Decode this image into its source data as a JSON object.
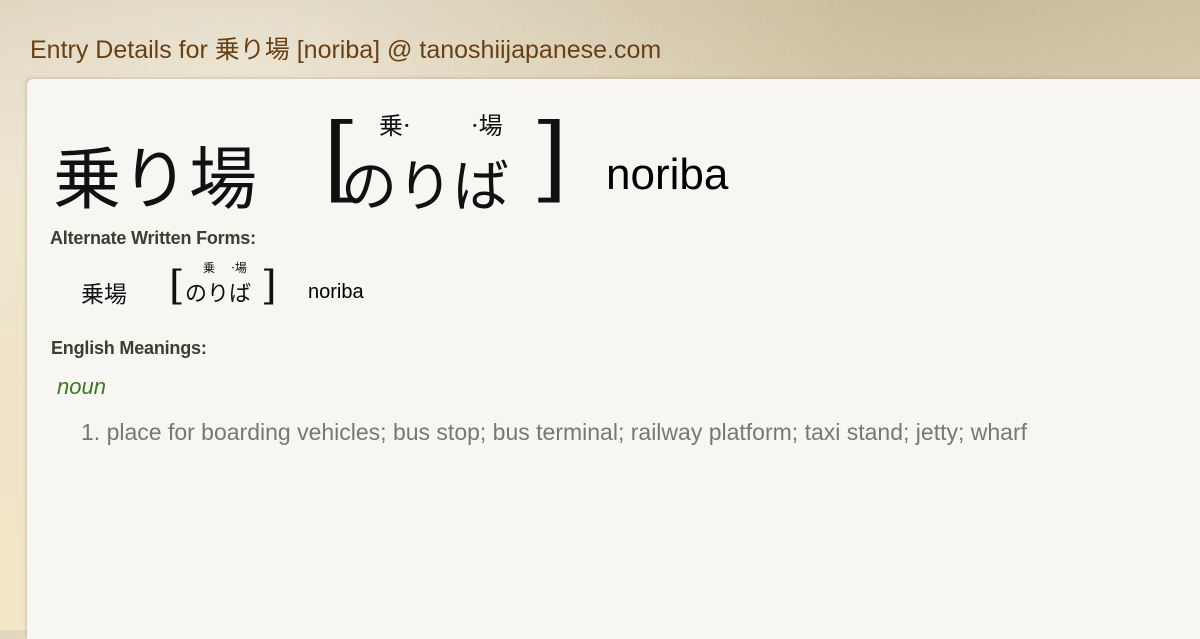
{
  "header": {
    "title": "Entry Details for 乗り場 [noriba] @ tanoshiijapanese.com"
  },
  "entry": {
    "kanji": "乗り場",
    "bracket_open": "[",
    "kana": "のりば",
    "bracket_close": "]",
    "furigana_left": "乗·",
    "furigana_right": "·場",
    "romaji": "noriba"
  },
  "alternate": {
    "label": "Alternate Written Forms:",
    "forms": [
      {
        "kanji": "乗場",
        "bracket_open": "[",
        "kana": "のりば",
        "bracket_close": "]",
        "furigana_left": "乗",
        "furigana_right": "·場",
        "romaji": "noriba"
      }
    ]
  },
  "meanings": {
    "label": "English Meanings:",
    "part_of_speech": "noun",
    "items": [
      "1. place for boarding vehicles; bus stop; bus terminal; railway platform; taxi stand; jetty; wharf"
    ]
  },
  "colors": {
    "header_text": "#6a3f12",
    "noun_label": "#3d7a1f",
    "meaning_text": "#777777",
    "card_background": "#f7f6f2"
  }
}
